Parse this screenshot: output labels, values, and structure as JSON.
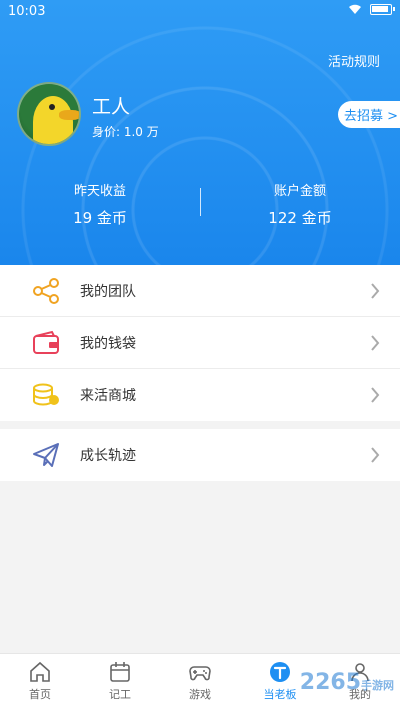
{
  "status_bar": {
    "time": "10:03"
  },
  "header": {
    "rules_link": "活动规则",
    "username": "工人",
    "worth": "身价: 1.0 万",
    "recruit_button": "去招募 >",
    "stats": [
      {
        "label": "昨天收益",
        "value": "19 金币"
      },
      {
        "label": "账户金额",
        "value": "122 金币"
      }
    ]
  },
  "menu": {
    "group1": [
      {
        "label": "我的团队",
        "icon": "share-icon",
        "color": "#f0a321"
      },
      {
        "label": "我的钱袋",
        "icon": "wallet-icon",
        "color": "#e8415a"
      },
      {
        "label": "来活商城",
        "icon": "coins-icon",
        "color": "#f0c21b"
      }
    ],
    "group2": [
      {
        "label": "成长轨迹",
        "icon": "paper-plane-icon",
        "color": "#5a6fb8"
      }
    ]
  },
  "tabbar": {
    "tabs": [
      {
        "label": "首页",
        "icon": "home-icon"
      },
      {
        "label": "记工",
        "icon": "calendar-icon"
      },
      {
        "label": "游戏",
        "icon": "gamepad-icon"
      },
      {
        "label": "当老板",
        "icon": "boss-icon",
        "active": true
      },
      {
        "label": "我的",
        "icon": "user-icon"
      }
    ]
  },
  "watermark": {
    "brand": "2265",
    "suffix": "手游网"
  },
  "colors": {
    "primary": "#1e8ff2",
    "background": "#f3f3f3"
  }
}
